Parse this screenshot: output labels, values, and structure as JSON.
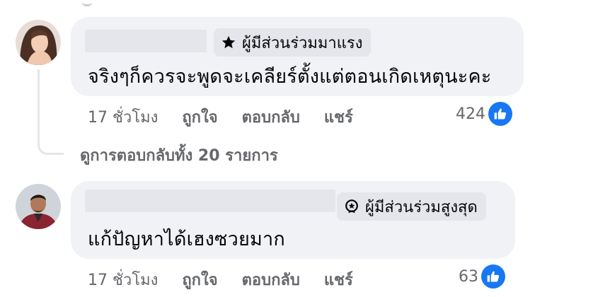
{
  "comments": [
    {
      "badge_label": "ผู้มีส่วนร่วมมาแรง",
      "badge_icon": "star-icon",
      "text": "จริงๆก็ควรจะพูดจะเคลียร์ตั้งแต่ตอนเกิดเหตุนะคะ",
      "time": "17 ชั่วโมง",
      "like_label": "ถูกใจ",
      "reply_label": "ตอบกลับ",
      "share_label": "แชร์",
      "reaction_count": "424"
    },
    {
      "badge_label": "ผู้มีส่วนร่วมสูงสุด",
      "badge_icon": "top-fan-medal-icon",
      "text": "แก้ปัญหาได้เฮงซวยมาก",
      "time": "17 ชั่วโมง",
      "like_label": "ถูกใจ",
      "reply_label": "ตอบกลับ",
      "share_label": "แชร์",
      "reaction_count": "63"
    }
  ],
  "view_replies_label": "ดูการตอบกลับทั้ง 20 รายการ",
  "colors": {
    "bubble": "#f0f2f5",
    "badge": "#e4e6eb",
    "secondary_text": "#65676b",
    "like_blue": "#1877f2"
  }
}
